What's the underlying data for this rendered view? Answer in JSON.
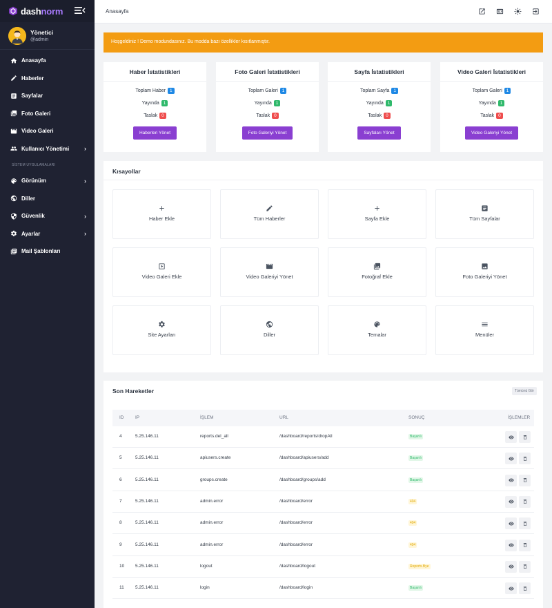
{
  "brand": {
    "part1": "dash",
    "part2": "norm"
  },
  "user": {
    "name": "Yönetici",
    "role": "@admin"
  },
  "nav": {
    "items": [
      {
        "label": "Anasayfa",
        "icon": "home-icon"
      },
      {
        "label": "Haberler",
        "icon": "pencil-icon"
      },
      {
        "label": "Sayfalar",
        "icon": "document-icon"
      },
      {
        "label": "Foto Galeri",
        "icon": "photo-library-icon"
      },
      {
        "label": "Video Galeri",
        "icon": "movie-icon"
      },
      {
        "label": "Kullanıcı Yönetimi",
        "icon": "users-icon",
        "has_children": true
      }
    ],
    "section_label": "SİSTEM UYGULAMALARI",
    "system_items": [
      {
        "label": "Görünüm",
        "icon": "palette-icon",
        "has_children": true
      },
      {
        "label": "Diller",
        "icon": "globe-icon"
      },
      {
        "label": "Güvenlik",
        "icon": "shield-icon",
        "has_children": true
      },
      {
        "label": "Ayarlar",
        "icon": "gear-icon",
        "has_children": true
      },
      {
        "label": "Mail Şablonları",
        "icon": "mail-template-icon"
      }
    ],
    "chevron": "›"
  },
  "topbar": {
    "breadcrumb": "Anasayfa"
  },
  "alert": {
    "text": "Hoşgeldiniz ! Demo modundasınız. Bu modda bazı özellikler kısıtlanmıştır."
  },
  "stats": [
    {
      "title": "Haber İstatistikleri",
      "rows": [
        {
          "label": "Toplam Haber",
          "value": "1"
        },
        {
          "label": "Yayında",
          "value": "1"
        },
        {
          "label": "Taslak",
          "value": "0"
        }
      ],
      "button": "Haberleri Yönet"
    },
    {
      "title": "Foto Galeri İstatistikleri",
      "rows": [
        {
          "label": "Toplam Galeri",
          "value": "1"
        },
        {
          "label": "Yayında",
          "value": "1"
        },
        {
          "label": "Taslak",
          "value": "0"
        }
      ],
      "button": "Foto Galeriyi Yönet"
    },
    {
      "title": "Sayfa İstatistikleri",
      "rows": [
        {
          "label": "Toplam Sayfa",
          "value": "1"
        },
        {
          "label": "Yayında",
          "value": "1"
        },
        {
          "label": "Taslak",
          "value": "0"
        }
      ],
      "button": "Sayfaları Yönet"
    },
    {
      "title": "Video Galeri İstatistikleri",
      "rows": [
        {
          "label": "Toplam Galeri",
          "value": "1"
        },
        {
          "label": "Yayında",
          "value": "1"
        },
        {
          "label": "Taslak",
          "value": "0"
        }
      ],
      "button": "Video Galeriyi Yönet"
    }
  ],
  "shortcuts": {
    "title": "Kısayollar",
    "items": [
      {
        "label": "Haber Ekle",
        "icon": "plus-icon"
      },
      {
        "label": "Tüm Haberler",
        "icon": "pencil-icon"
      },
      {
        "label": "Sayfa Ekle",
        "icon": "plus-icon"
      },
      {
        "label": "Tüm Sayfalar",
        "icon": "document-icon"
      },
      {
        "label": "Video Galeri Ekle",
        "icon": "play-box-icon"
      },
      {
        "label": "Video Galeriyi Yönet",
        "icon": "movie-icon"
      },
      {
        "label": "Fotoğraf Ekle",
        "icon": "photo-library-icon"
      },
      {
        "label": "Foto Galeriyi Yönet",
        "icon": "image-icon"
      },
      {
        "label": "Site Ayarları",
        "icon": "gear-icon"
      },
      {
        "label": "Diller",
        "icon": "globe-icon"
      },
      {
        "label": "Temalar",
        "icon": "palette-icon"
      },
      {
        "label": "Menüler",
        "icon": "menu-lines-icon"
      }
    ]
  },
  "activity": {
    "title": "Son Hareketler",
    "all_button": "Tümünü Gör",
    "columns": [
      "ID",
      "IP",
      "İŞLEM",
      "URL",
      "SONUÇ",
      "İŞLEMLER"
    ],
    "rows": [
      {
        "id": "4",
        "ip": "5.25.146.11",
        "action": "reports.del_all",
        "url": "/dashboard/reports/dropAll",
        "result": "Başarılı",
        "status": "ok"
      },
      {
        "id": "5",
        "ip": "5.25.146.11",
        "action": "apiusers.create",
        "url": "/dashboard/apiusers/add",
        "result": "Başarılı",
        "status": "ok"
      },
      {
        "id": "6",
        "ip": "5.25.146.11",
        "action": "groups.create",
        "url": "/dashboard/groups/add",
        "result": "Başarılı",
        "status": "ok"
      },
      {
        "id": "7",
        "ip": "5.25.146.11",
        "action": "admin.error",
        "url": "/dashboard/error",
        "result": "404",
        "status": "warn"
      },
      {
        "id": "8",
        "ip": "5.25.146.11",
        "action": "admin.error",
        "url": "/dashboard/error",
        "result": "404",
        "status": "warn"
      },
      {
        "id": "9",
        "ip": "5.25.146.11",
        "action": "admin.error",
        "url": "/dashboard/error",
        "result": "404",
        "status": "warn"
      },
      {
        "id": "10",
        "ip": "5.25.146.11",
        "action": "logout",
        "url": "/dashboard/logout",
        "result": "Reports.Bye",
        "status": "warn"
      },
      {
        "id": "11",
        "ip": "5.25.146.11",
        "action": "login",
        "url": "/dashboard/login",
        "result": "Başarılı",
        "status": "ok"
      }
    ]
  },
  "colors": {
    "sidebar": "#1f2232",
    "accent": "#8a3fd1",
    "alert": "#f39c12",
    "success": "#2fb96b",
    "danger": "#ef4d4d",
    "info": "#1e88e5"
  }
}
